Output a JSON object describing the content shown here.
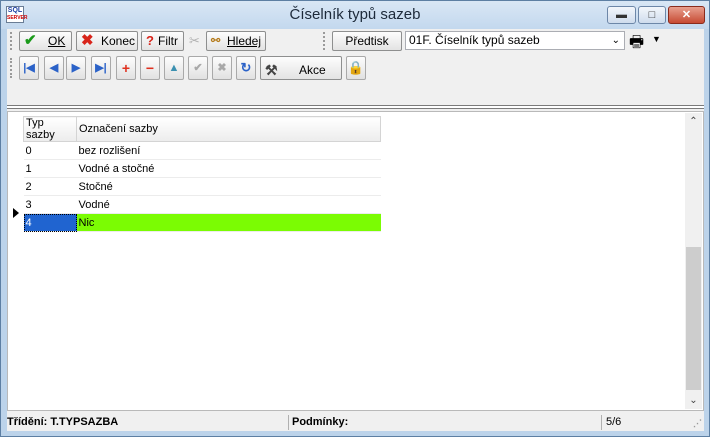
{
  "window": {
    "title": "Číselník typů sazeb",
    "app_icon_top": "SQL",
    "app_icon_bottom": "SERVER",
    "minimize_glyph": "▬",
    "maximize_glyph": "□",
    "close_glyph": "✕"
  },
  "toolbar": {
    "ok_label": "OK",
    "ok_icon": "checkmark-icon",
    "konec_label": "Konec",
    "konec_icon": "x-icon",
    "filtr_label": "Filtr",
    "filtr_icon": "question-icon",
    "hledej_label": "Hledej",
    "predtisk_label": "Předtisk",
    "report_select_value": "01F. Číselník typů sazeb",
    "printer_icon": "printer-icon",
    "akce_label": "Akce",
    "akce_icon": "tools-icon",
    "lock_icon": "lock-icon"
  },
  "navigation": {
    "first_icon": "first-record-icon",
    "prev_icon": "prev-record-icon",
    "next_icon": "next-record-icon",
    "last_icon": "last-record-icon",
    "add_icon": "add-icon",
    "delete_icon": "delete-icon",
    "up_icon": "up-icon",
    "confirm_icon": "confirm-icon",
    "cancel_icon": "cancel-icon",
    "refresh_icon": "refresh-icon"
  },
  "grid": {
    "columns": [
      "Typ sazby",
      "Označení sazby"
    ],
    "rows": [
      {
        "typ": "0",
        "oznaceni": "bez rozlišení"
      },
      {
        "typ": "1",
        "oznaceni": "Vodné a stočné"
      },
      {
        "typ": "2",
        "oznaceni": "Stočné"
      },
      {
        "typ": "3",
        "oznaceni": "Vodné"
      },
      {
        "typ": "4",
        "oznaceni": "Nic"
      }
    ],
    "selected_row": 4,
    "selected_color": "#7bfc03"
  },
  "status": {
    "trideni": "Třídění: T.TYPSAZBA",
    "podminky": "Podmínky:",
    "position": "5/6"
  },
  "colors": {
    "title_bg": "#c3d8ee",
    "selection_cell": "#2064d0",
    "close_button": "#c74a33"
  }
}
